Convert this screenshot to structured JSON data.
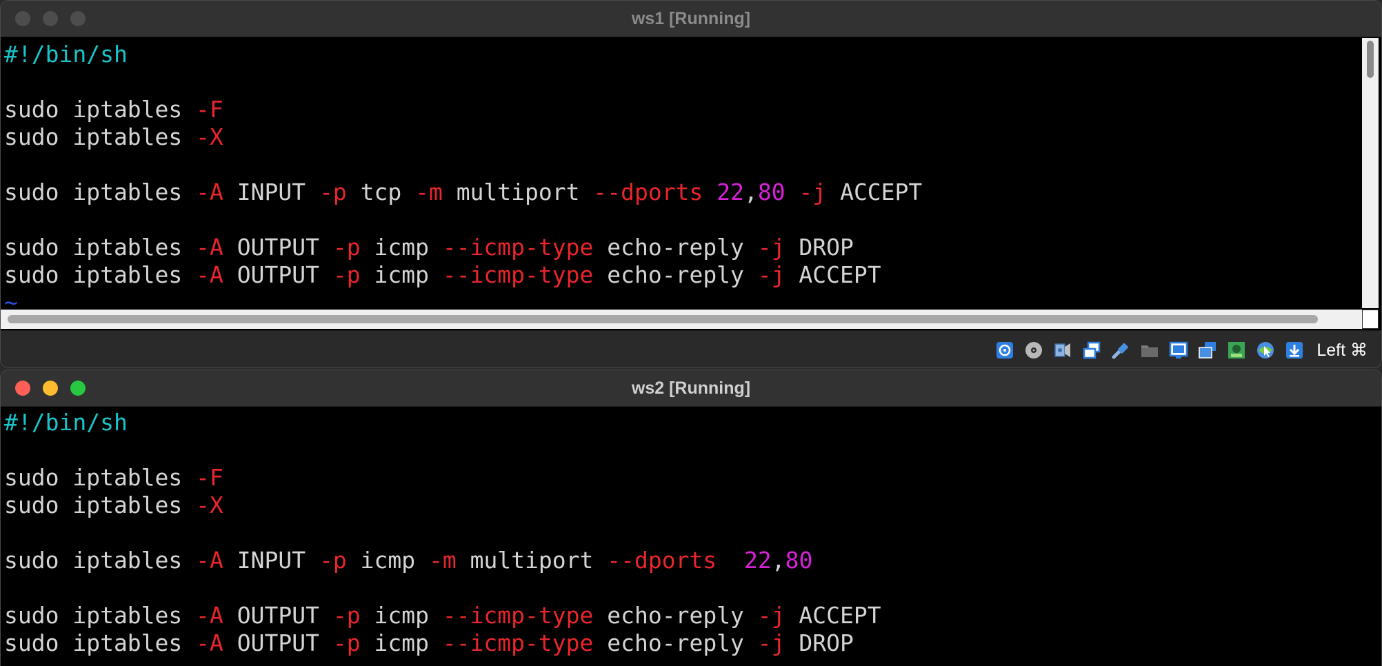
{
  "windows": [
    {
      "title": "ws1 [Running]",
      "lines": [
        [
          {
            "t": "#!/bin/sh",
            "c": "cyan"
          }
        ],
        [],
        [
          {
            "t": "sudo iptables "
          },
          {
            "t": "-F",
            "c": "red"
          }
        ],
        [
          {
            "t": "sudo iptables "
          },
          {
            "t": "-X",
            "c": "red"
          }
        ],
        [],
        [
          {
            "t": "sudo iptables "
          },
          {
            "t": "-A",
            "c": "red"
          },
          {
            "t": " INPUT "
          },
          {
            "t": "-p",
            "c": "red"
          },
          {
            "t": " tcp "
          },
          {
            "t": "-m",
            "c": "red"
          },
          {
            "t": " multiport "
          },
          {
            "t": "--dports",
            "c": "red"
          },
          {
            "t": " "
          },
          {
            "t": "22",
            "c": "mag"
          },
          {
            "t": ","
          },
          {
            "t": "80",
            "c": "mag"
          },
          {
            "t": " "
          },
          {
            "t": "-j",
            "c": "red"
          },
          {
            "t": " ACCEPT"
          }
        ],
        [],
        [
          {
            "t": "sudo iptables "
          },
          {
            "t": "-A",
            "c": "red"
          },
          {
            "t": " OUTPUT "
          },
          {
            "t": "-p",
            "c": "red"
          },
          {
            "t": " icmp "
          },
          {
            "t": "--icmp-type",
            "c": "red"
          },
          {
            "t": " echo-reply "
          },
          {
            "t": "-j",
            "c": "red"
          },
          {
            "t": " DROP"
          }
        ],
        [
          {
            "t": "sudo iptables "
          },
          {
            "t": "-A",
            "c": "red"
          },
          {
            "t": " OUTPUT "
          },
          {
            "t": "-p",
            "c": "red"
          },
          {
            "t": " icmp "
          },
          {
            "t": "--icmp-type",
            "c": "red"
          },
          {
            "t": " echo-reply "
          },
          {
            "t": "-j",
            "c": "red"
          },
          {
            "t": " ACCEPT"
          }
        ],
        [
          {
            "t": "~",
            "c": "blue"
          }
        ]
      ]
    },
    {
      "title": "ws2 [Running]",
      "lines": [
        [
          {
            "t": "#!/bin/sh",
            "c": "cyan"
          }
        ],
        [],
        [
          {
            "t": "sudo iptables "
          },
          {
            "t": "-F",
            "c": "red"
          }
        ],
        [
          {
            "t": "sudo iptables "
          },
          {
            "t": "-X",
            "c": "red"
          }
        ],
        [],
        [
          {
            "t": "sudo iptables "
          },
          {
            "t": "-A",
            "c": "red"
          },
          {
            "t": " INPUT "
          },
          {
            "t": "-p",
            "c": "red"
          },
          {
            "t": " icmp "
          },
          {
            "t": "-m",
            "c": "red"
          },
          {
            "t": " multiport "
          },
          {
            "t": "--dports",
            "c": "red"
          },
          {
            "t": "  "
          },
          {
            "t": "22",
            "c": "mag"
          },
          {
            "t": ","
          },
          {
            "t": "80",
            "c": "mag"
          }
        ],
        [],
        [
          {
            "t": "sudo iptables "
          },
          {
            "t": "-A",
            "c": "red"
          },
          {
            "t": " OUTPUT "
          },
          {
            "t": "-p",
            "c": "red"
          },
          {
            "t": " icmp "
          },
          {
            "t": "--icmp-type",
            "c": "red"
          },
          {
            "t": " echo-reply "
          },
          {
            "t": "-j",
            "c": "red"
          },
          {
            "t": " ACCEPT"
          }
        ],
        [
          {
            "t": "sudo iptables "
          },
          {
            "t": "-A",
            "c": "red"
          },
          {
            "t": " OUTPUT "
          },
          {
            "t": "-p",
            "c": "red"
          },
          {
            "t": " icmp "
          },
          {
            "t": "--icmp-type",
            "c": "red"
          },
          {
            "t": " echo-reply "
          },
          {
            "t": "-j",
            "c": "red"
          },
          {
            "t": " DROP"
          }
        ],
        [
          {
            "t": "~",
            "c": "blue"
          }
        ]
      ]
    }
  ],
  "statusbar": {
    "icons": [
      "hard-disk-icon",
      "optical-drive-icon",
      "audio-icon",
      "network-icon",
      "usb-icon",
      "shared-folders-icon",
      "display-icon",
      "screen-capture-icon",
      "video-capture-icon",
      "mouse-integration-icon",
      "download-icon"
    ],
    "host_key_label": "Left ⌘"
  },
  "colors": {
    "cyan": "#17c5c9",
    "red": "#e8262c",
    "magenta": "#d821d8",
    "text": "#d4d4d4",
    "background": "#000000"
  }
}
